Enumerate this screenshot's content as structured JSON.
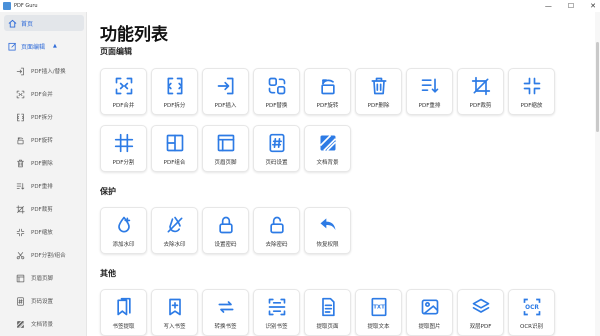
{
  "app": {
    "title": "PDF Guru"
  },
  "window_controls": [
    {
      "name": "minimize-button",
      "glyph": "—"
    },
    {
      "name": "maximize-button",
      "glyph": "☐"
    },
    {
      "name": "close-button",
      "glyph": "✕"
    }
  ],
  "sidebar": {
    "home": {
      "label": "首页",
      "icon": "home-icon"
    },
    "section": {
      "label": "页面编辑",
      "icon": "edit-icon",
      "caret": "▲"
    },
    "items": [
      {
        "label": "PDF插入/替换",
        "icon": "insert-icon"
      },
      {
        "label": "PDF合并",
        "icon": "merge-icon"
      },
      {
        "label": "PDF拆分",
        "icon": "split-icon"
      },
      {
        "label": "PDF旋转",
        "icon": "rotate-icon"
      },
      {
        "label": "PDF删除",
        "icon": "delete-icon"
      },
      {
        "label": "PDF重排",
        "icon": "reorder-icon"
      },
      {
        "label": "PDF裁剪",
        "icon": "crop-icon"
      },
      {
        "label": "PDF缩放",
        "icon": "scale-icon"
      },
      {
        "label": "PDF分割/组合",
        "icon": "cut-icon"
      },
      {
        "label": "页眉页脚",
        "icon": "header-footer-icon"
      },
      {
        "label": "页码设置",
        "icon": "page-number-icon"
      },
      {
        "label": "文档背景",
        "icon": "background-icon"
      }
    ]
  },
  "main": {
    "title": "功能列表",
    "sections": [
      {
        "title": "页面编辑",
        "tiles": [
          {
            "label": "PDF合并",
            "icon": "merge-icon"
          },
          {
            "label": "PDF拆分",
            "icon": "split-icon"
          },
          {
            "label": "PDF插入",
            "icon": "insert-icon"
          },
          {
            "label": "PDF替换",
            "icon": "replace-icon"
          },
          {
            "label": "PDF旋转",
            "icon": "rotate-icon"
          },
          {
            "label": "PDF删除",
            "icon": "delete-icon"
          },
          {
            "label": "PDF重排",
            "icon": "reorder-icon"
          },
          {
            "label": "PDF裁剪",
            "icon": "crop-icon"
          },
          {
            "label": "PDF缩放",
            "icon": "scale-icon"
          },
          {
            "label": "PDF分割",
            "icon": "grid-split-icon"
          },
          {
            "label": "PDF组合",
            "icon": "combine-icon"
          },
          {
            "label": "页眉页脚",
            "icon": "header-footer-icon"
          },
          {
            "label": "页码设置",
            "icon": "page-number-icon"
          },
          {
            "label": "文档背景",
            "icon": "background-icon"
          }
        ]
      },
      {
        "title": "保护",
        "tiles": [
          {
            "label": "添加水印",
            "icon": "watermark-icon"
          },
          {
            "label": "去除水印",
            "icon": "remove-watermark-icon"
          },
          {
            "label": "设置密码",
            "icon": "lock-icon"
          },
          {
            "label": "去除密码",
            "icon": "unlock-icon"
          },
          {
            "label": "恢复权限",
            "icon": "undo-icon"
          }
        ]
      },
      {
        "title": "其他",
        "tiles": [
          {
            "label": "书签提取",
            "icon": "bookmarks-icon"
          },
          {
            "label": "写入书签",
            "icon": "bookmark-add-icon"
          },
          {
            "label": "转换书签",
            "icon": "convert-icon"
          },
          {
            "label": "识别书签",
            "icon": "scan-icon"
          },
          {
            "label": "提取页面",
            "icon": "page-icon"
          },
          {
            "label": "提取文本",
            "icon": "txt-icon"
          },
          {
            "label": "提取图片",
            "icon": "image-icon"
          },
          {
            "label": "双层PDF",
            "icon": "layers-icon"
          },
          {
            "label": "OCR识别",
            "icon": "ocr-icon"
          }
        ]
      }
    ]
  },
  "colors": {
    "accent": "#2f6bd8",
    "icon_blue": "#2d7be5"
  }
}
